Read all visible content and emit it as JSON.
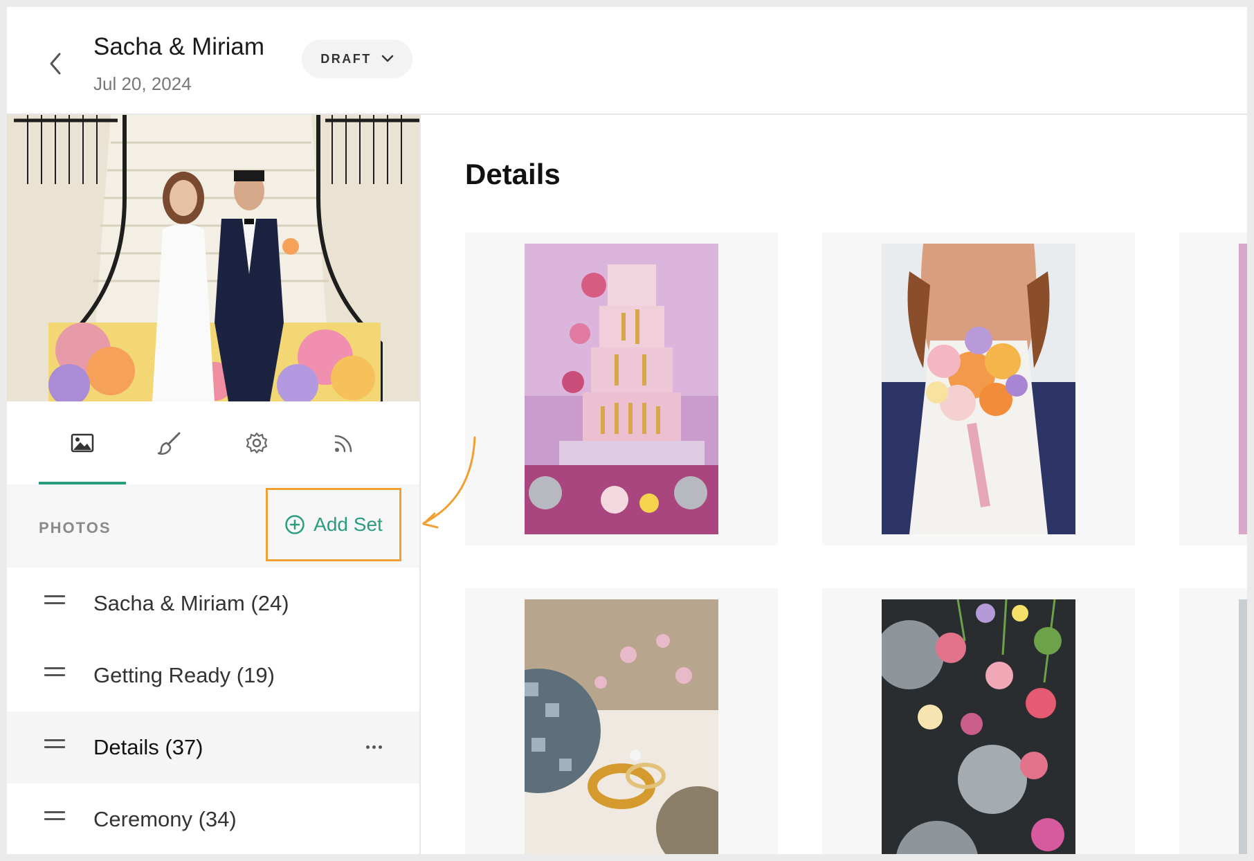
{
  "header": {
    "title": "Sacha & Miriam",
    "date": "Jul 20, 2024",
    "status_label": "DRAFT"
  },
  "sidebar": {
    "tabs": [
      {
        "icon": "image-icon"
      },
      {
        "icon": "brush-icon"
      },
      {
        "icon": "gear-icon"
      },
      {
        "icon": "rss-icon"
      }
    ],
    "photos_label": "PHOTOS",
    "add_set_label": "Add Set",
    "sets": [
      {
        "label": "Sacha & Miriam (24)"
      },
      {
        "label": "Getting Ready (19)"
      },
      {
        "label": "Details (37)",
        "active": true
      },
      {
        "label": "Ceremony (34)"
      }
    ]
  },
  "main": {
    "title": "Details"
  },
  "colors": {
    "accent": "#2a9d7f",
    "highlight": "#f0a033"
  }
}
